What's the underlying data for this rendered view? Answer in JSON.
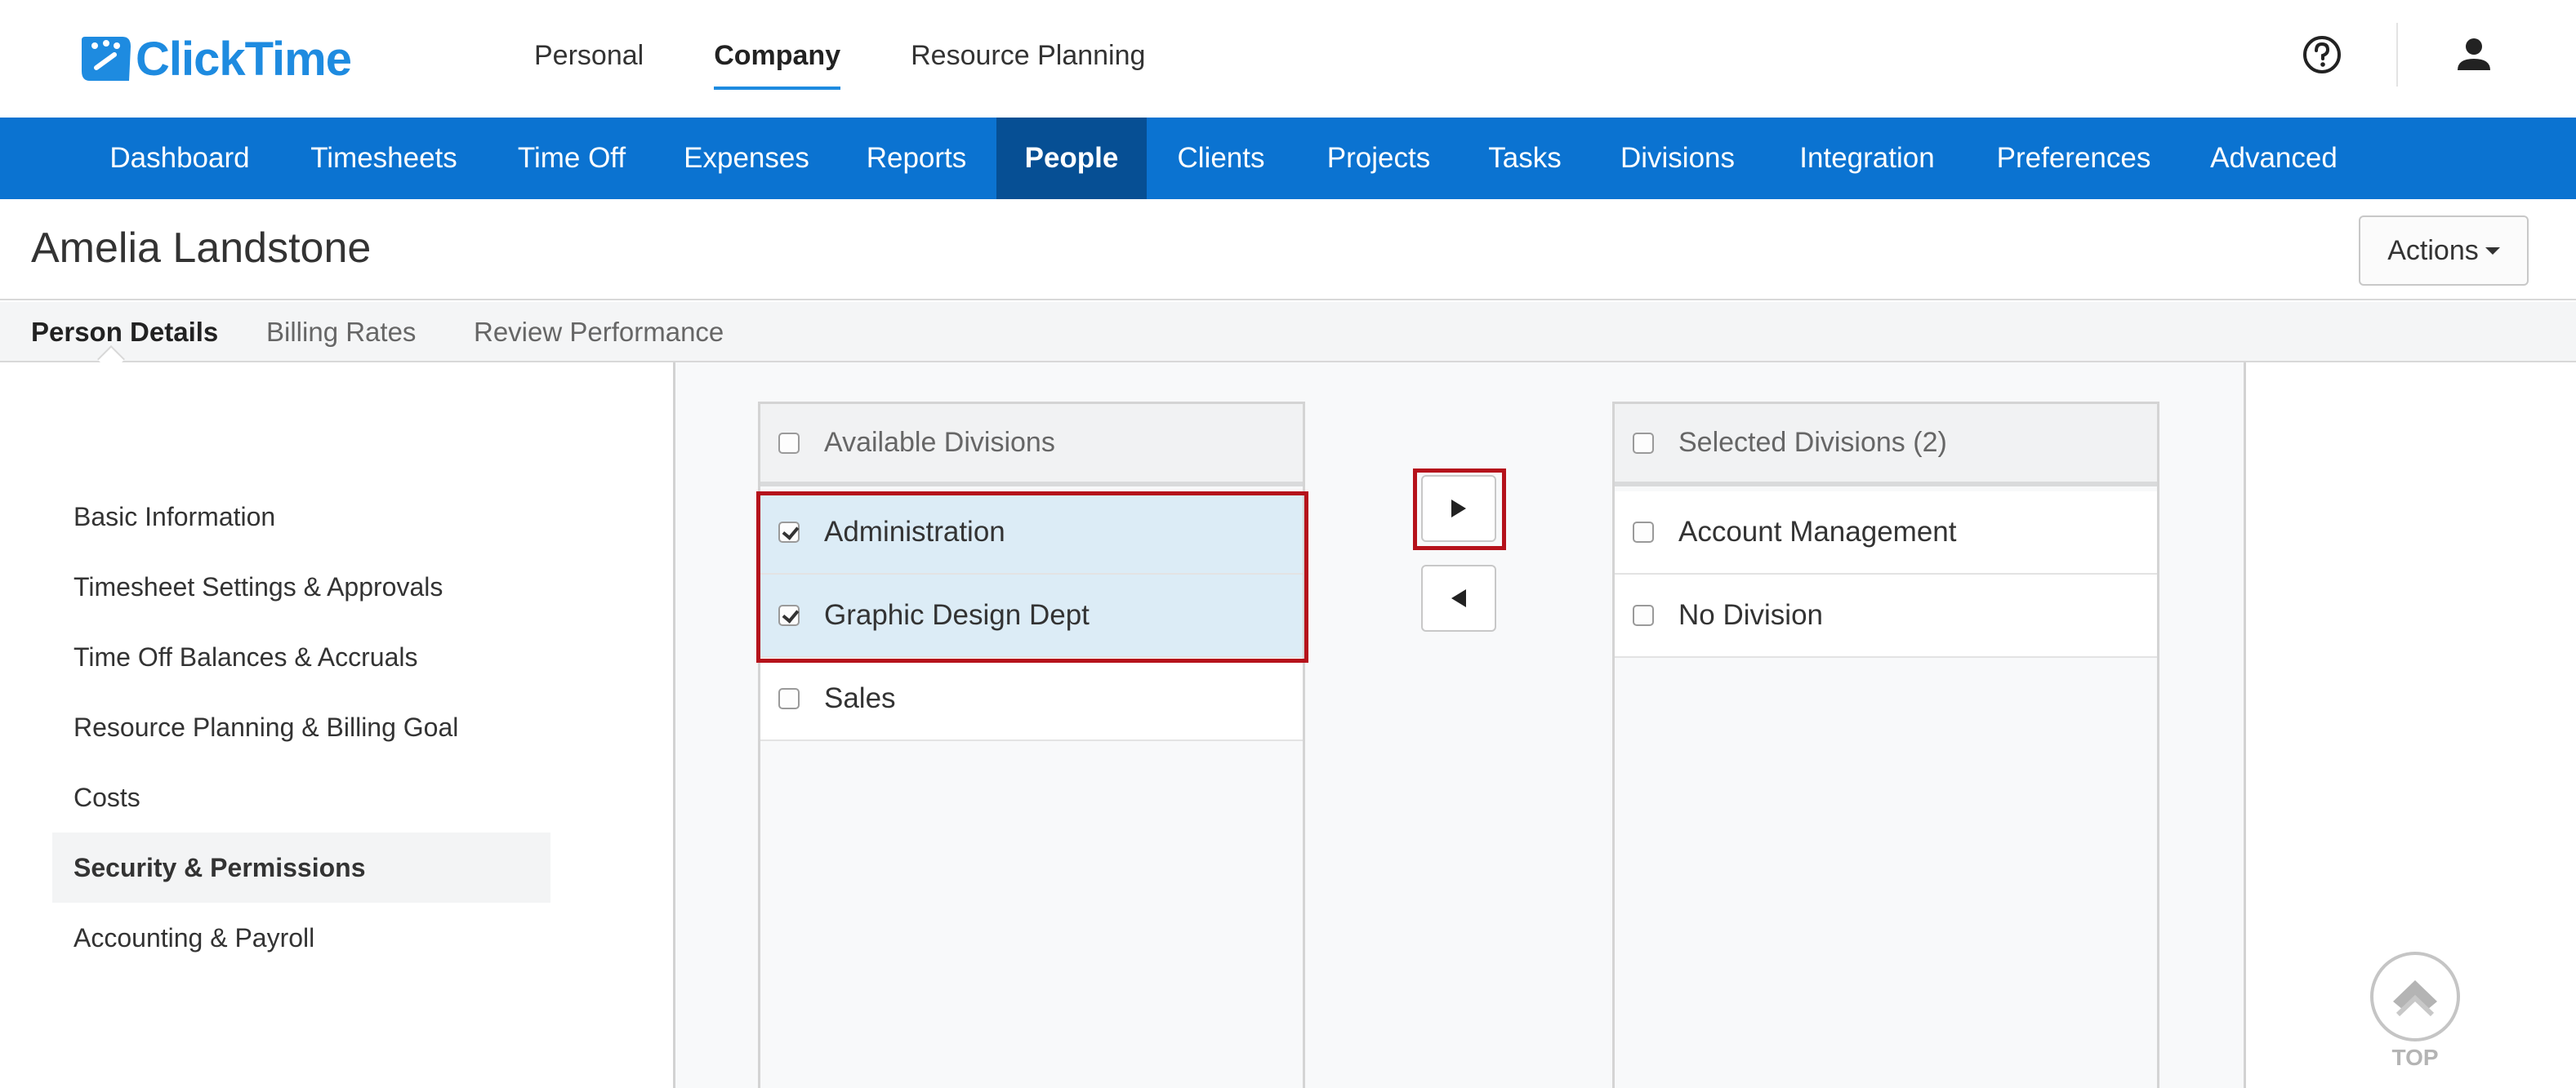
{
  "header": {
    "logo_text": "ClickTime",
    "nav": [
      {
        "label": "Personal",
        "active": false
      },
      {
        "label": "Company",
        "active": true
      },
      {
        "label": "Resource Planning",
        "active": false
      }
    ],
    "icons": [
      "help-icon",
      "user-icon"
    ]
  },
  "main_nav": {
    "items": [
      {
        "label": "Dashboard",
        "active": false
      },
      {
        "label": "Timesheets",
        "active": false
      },
      {
        "label": "Time Off",
        "active": false
      },
      {
        "label": "Expenses",
        "active": false
      },
      {
        "label": "Reports",
        "active": false
      },
      {
        "label": "People",
        "active": true
      },
      {
        "label": "Clients",
        "active": false
      },
      {
        "label": "Projects",
        "active": false
      },
      {
        "label": "Tasks",
        "active": false
      },
      {
        "label": "Divisions",
        "active": false
      },
      {
        "label": "Integration",
        "active": false
      },
      {
        "label": "Preferences",
        "active": false
      },
      {
        "label": "Advanced",
        "active": false
      }
    ]
  },
  "page": {
    "title": "Amelia Landstone",
    "actions_label": "Actions"
  },
  "sub_tabs": [
    {
      "label": "Person Details",
      "active": true
    },
    {
      "label": "Billing Rates",
      "active": false
    },
    {
      "label": "Review Performance",
      "active": false
    }
  ],
  "side_menu": [
    {
      "label": "Basic Information",
      "active": false
    },
    {
      "label": "Timesheet Settings & Approvals",
      "active": false
    },
    {
      "label": "Time Off Balances & Accruals",
      "active": false
    },
    {
      "label": "Resource Planning & Billing Goal",
      "active": false
    },
    {
      "label": "Costs",
      "active": false
    },
    {
      "label": "Security & Permissions",
      "active": true
    },
    {
      "label": "Accounting & Payroll",
      "active": false
    }
  ],
  "available_divisions": {
    "header": "Available Divisions",
    "items": [
      {
        "label": "Administration",
        "checked": true
      },
      {
        "label": "Graphic Design Dept",
        "checked": true
      },
      {
        "label": "Sales",
        "checked": false
      }
    ]
  },
  "selected_divisions": {
    "header": "Selected Divisions (2)",
    "items": [
      {
        "label": "Account Management",
        "checked": false
      },
      {
        "label": "No Division",
        "checked": false
      }
    ]
  },
  "move_buttons": {
    "add_icon": "arrow-right-icon",
    "remove_icon": "arrow-left-icon"
  },
  "back_to_top": {
    "label": "TOP"
  },
  "colors": {
    "brand_blue": "#1e8be0",
    "nav_blue": "#0b73d1",
    "nav_active": "#064f94",
    "highlight_red": "#b5121b",
    "selected_row": "#dcecf6"
  }
}
